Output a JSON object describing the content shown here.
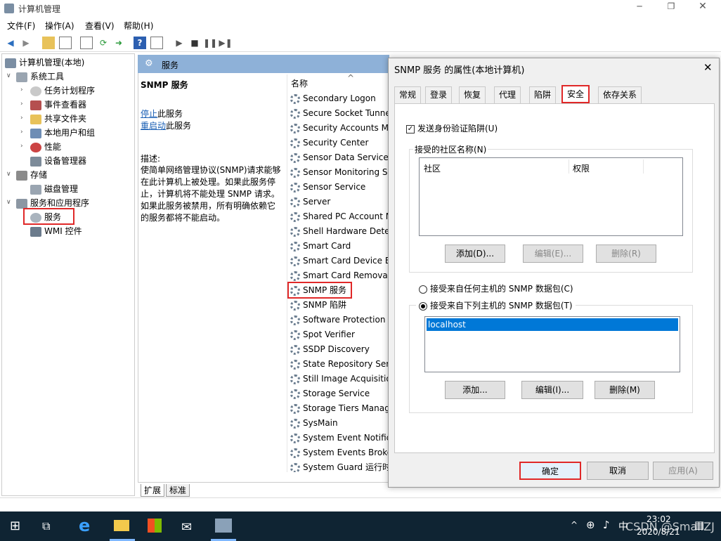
{
  "window": {
    "title": "计算机管理"
  },
  "menu": [
    "文件(F)",
    "操作(A)",
    "查看(V)",
    "帮助(H)"
  ],
  "tree": {
    "root": "计算机管理(本地)",
    "system_tools": "系统工具",
    "task_scheduler": "任务计划程序",
    "event_viewer": "事件查看器",
    "shared_folders": "共享文件夹",
    "local_users": "本地用户和组",
    "performance": "性能",
    "device_manager": "设备管理器",
    "storage": "存储",
    "disk_management": "磁盘管理",
    "services_apps": "服务和应用程序",
    "services": "服务",
    "wmi": "WMI 控件"
  },
  "center": {
    "header": "服务",
    "selected_title": "SNMP 服务",
    "stop_link": "停止",
    "stop_suffix": "此服务",
    "restart_link": "重启动",
    "restart_suffix": "此服务",
    "desc_label": "描述:",
    "desc_text": "使简单网络管理协议(SNMP)请求能够在此计算机上被处理。如果此服务停止，计算机将不能处理 SNMP 请求。如果此服务被禁用，所有明确依赖它的服务都将不能启动。",
    "col_name": "名称",
    "tab_extended": "扩展",
    "tab_standard": "标准",
    "services": [
      "Secondary Logon",
      "Secure Socket Tunne",
      "Security Accounts Ma",
      "Security Center",
      "Sensor Data Service",
      "Sensor Monitoring S",
      "Sensor Service",
      "Server",
      "Shared PC Account M",
      "Shell Hardware Detec",
      "Smart Card",
      "Smart Card Device Er",
      "Smart Card Removal",
      "SNMP 服务",
      "SNMP 陷阱",
      "Software Protection",
      "Spot Verifier",
      "SSDP Discovery",
      "State Repository Serv",
      "Still Image Acquisitio",
      "Storage Service",
      "Storage Tiers Manag",
      "SysMain",
      "System Event Notifica",
      "System Events Broke",
      "System Guard 运行时"
    ]
  },
  "dialog": {
    "title": "SNMP 服务 的属性(本地计算机)",
    "tabs": [
      "常规",
      "登录",
      "恢复",
      "代理",
      "陷阱",
      "安全",
      "依存关系"
    ],
    "send_auth_trap": "发送身份验证陷阱(U)",
    "accepted_communities": "接受的社区名称(N)",
    "col_community": "社区",
    "col_rights": "权限",
    "add1": "添加(D)...",
    "edit1": "编辑(E)...",
    "remove1": "删除(R)",
    "radio_any": "接受来自任何主机的 SNMP 数据包(C)",
    "radio_these": "接受来自下列主机的 SNMP 数据包(T)",
    "host": "localhost",
    "add2": "添加...",
    "edit2": "编辑(I)...",
    "remove2": "删除(M)",
    "ok": "确定",
    "cancel": "取消",
    "apply": "应用(A)"
  },
  "taskbar": {
    "ime": "中",
    "time": "23:02",
    "date": "2020/8/21",
    "watermark": "CSDN @SmallZJ"
  }
}
